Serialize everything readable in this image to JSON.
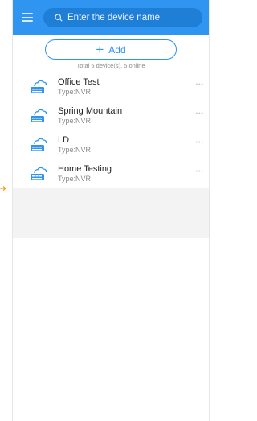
{
  "header": {
    "search_placeholder": "Enter the device name"
  },
  "toolbar": {
    "add_label": "Add",
    "summary": "Total 5 device(s), 5 online"
  },
  "devices": [
    {
      "name": "Office Test",
      "type": "Type:NVR"
    },
    {
      "name": "Spring Mountain",
      "type": "Type:NVR"
    },
    {
      "name": "LD",
      "type": "Type:NVR"
    },
    {
      "name": "Home Testing",
      "type": "Type:NVR"
    }
  ],
  "icons": {
    "menu": "menu-icon",
    "search": "search-icon",
    "add": "plus-icon",
    "device": "cloud-nvr-icon",
    "more": "more-dots-icon",
    "arrow": "arrow-right-icon"
  },
  "colors": {
    "brand": "#2f95f0",
    "search_bg": "#1f7fd6",
    "arrow": "#f0a030"
  }
}
